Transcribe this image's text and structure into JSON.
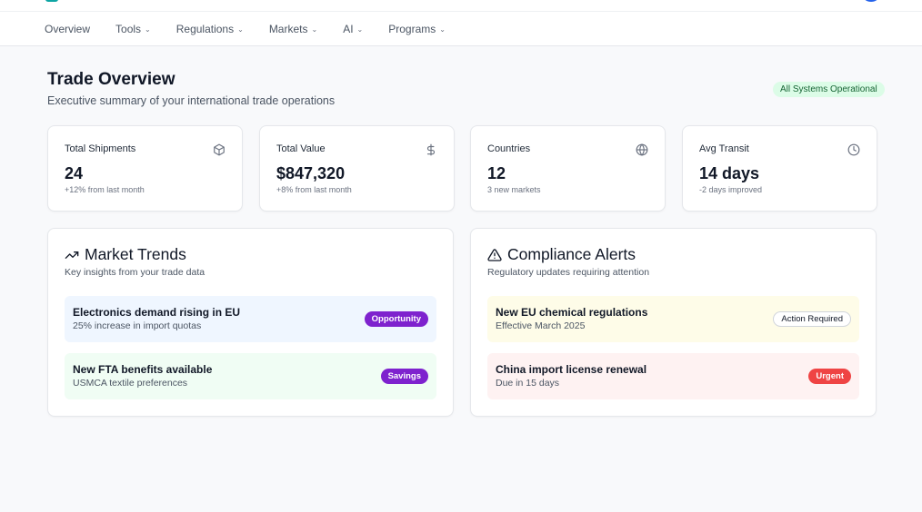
{
  "nav": {
    "items": [
      {
        "label": "Overview",
        "dropdown": false
      },
      {
        "label": "Tools",
        "dropdown": true
      },
      {
        "label": "Regulations",
        "dropdown": true
      },
      {
        "label": "Markets",
        "dropdown": true
      },
      {
        "label": "AI",
        "dropdown": true
      },
      {
        "label": "Programs",
        "dropdown": true
      }
    ]
  },
  "header": {
    "title": "Trade Overview",
    "subtitle": "Executive summary of your international trade operations",
    "status_badge": "All Systems Operational"
  },
  "stats": [
    {
      "label": "Total Shipments",
      "value": "24",
      "note": "+12% from last month",
      "icon": "package-icon"
    },
    {
      "label": "Total Value",
      "value": "$847,320",
      "note": "+8% from last month",
      "icon": "dollar-icon"
    },
    {
      "label": "Countries",
      "value": "12",
      "note": "3 new markets",
      "icon": "globe-icon"
    },
    {
      "label": "Avg Transit",
      "value": "14 days",
      "note": "-2 days improved",
      "icon": "clock-icon"
    }
  ],
  "market_trends": {
    "title": "Market Trends",
    "subtitle": "Key insights from your trade data",
    "icon": "trending-up-icon",
    "items": [
      {
        "title": "Electronics demand rising in EU",
        "subtitle": "25% increase in import quotas",
        "badge": "Opportunity",
        "bg": "#eff6ff"
      },
      {
        "title": "New FTA benefits available",
        "subtitle": "USMCA textile preferences",
        "badge": "Savings",
        "bg": "#f0fdf4"
      }
    ]
  },
  "compliance_alerts": {
    "title": "Compliance Alerts",
    "subtitle": "Regulatory updates requiring attention",
    "icon": "alert-triangle-icon",
    "items": [
      {
        "title": "New EU chemical regulations",
        "subtitle": "Effective March 2025",
        "badge": "Action Required",
        "bg": "#fefce8"
      },
      {
        "title": "China import license renewal",
        "subtitle": "Due in 15 days",
        "badge": "Urgent",
        "bg": "#fef2f2"
      }
    ]
  },
  "colors": {
    "accent_purple": "#7e22ce",
    "success_green": "#166534",
    "urgent_red": "#ef4444"
  }
}
